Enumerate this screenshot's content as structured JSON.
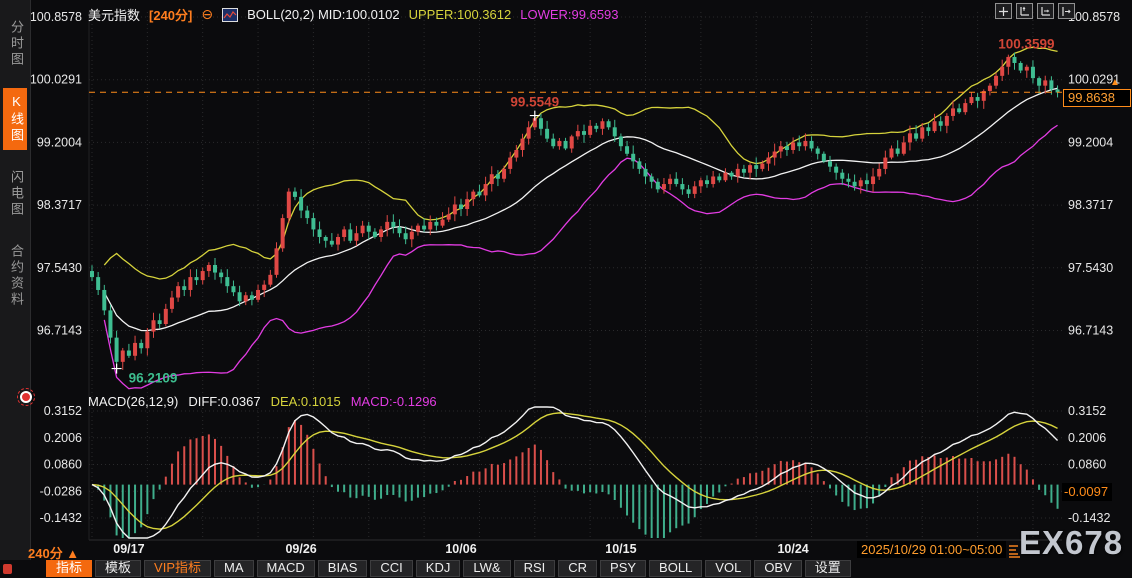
{
  "header": {
    "symbol": "美元指数",
    "period": "[240分]",
    "collapse_icon": "⊖",
    "boll_label": "BOLL(20,2)",
    "mid": "MID:100.0102",
    "upper": "UPPER:100.3612",
    "lower": "LOWER:99.6593"
  },
  "sidebar": {
    "tabs": [
      {
        "label": "分时图",
        "active": false
      },
      {
        "label": "K线图",
        "active": true
      },
      {
        "label": "闪电图",
        "active": false
      },
      {
        "label": "合约资料",
        "active": false
      }
    ]
  },
  "topright_buttons": [
    "crosshair",
    "scale-vertical-axis",
    "scale-horizontal-axis",
    "shift-right"
  ],
  "price_axis": {
    "current": "99.8638",
    "current_arrow": "▲"
  },
  "macd_header": {
    "name": "MACD(26,12,9)",
    "diff": "DIFF:0.0367",
    "dea": "DEA:0.1015",
    "macd": "MACD:-0.1296"
  },
  "macd_axis": {
    "current": "-0.0097"
  },
  "xaxis": {
    "period_label": "240分 ▲",
    "current_range": "2025/10/29 01:00~05:00"
  },
  "toolbar": {
    "items": [
      {
        "label": "指标",
        "variant": "active"
      },
      {
        "label": "模板",
        "variant": "plain"
      },
      {
        "label": "VIP指标",
        "variant": "vip"
      },
      {
        "label": "MA",
        "variant": "plain"
      },
      {
        "label": "MACD",
        "variant": "plain"
      },
      {
        "label": "BIAS",
        "variant": "plain"
      },
      {
        "label": "CCI",
        "variant": "plain"
      },
      {
        "label": "KDJ",
        "variant": "plain"
      },
      {
        "label": "LW&",
        "variant": "plain"
      },
      {
        "label": "RSI",
        "variant": "plain"
      },
      {
        "label": "CR",
        "variant": "plain"
      },
      {
        "label": "PSY",
        "variant": "plain"
      },
      {
        "label": "BOLL",
        "variant": "plain"
      },
      {
        "label": "VOL",
        "variant": "plain"
      },
      {
        "label": "OBV",
        "variant": "plain"
      },
      {
        "label": "设置",
        "variant": "plain"
      }
    ]
  },
  "watermark": "EX678",
  "colors": {
    "up": "#e04845",
    "down": "#3fbe92",
    "boll_upper": "#d6d33c",
    "boll_mid": "#f2f2f2",
    "boll_lower": "#e23ce2",
    "macd_bar_pos": "#da4f4b",
    "macd_bar_neg": "#3fae8c",
    "diff_line": "#f2f2f2",
    "dea_line": "#d6d33c",
    "grid": "#2a2a2c",
    "axis_text": "#e8e8e8",
    "orange": "#ff8c1a",
    "annot_red": "#d04536",
    "annot_green": "#3dbd8e"
  },
  "chart_data": {
    "type": "candlestick+macd",
    "title": "美元指数 240分 K线 + BOLL(20,2) + MACD(26,12,9)",
    "price_axis_ticks": [
      "100.8578",
      "100.0291",
      "99.2004",
      "98.3717",
      "97.5430",
      "96.7143"
    ],
    "macd_axis_ticks": [
      "0.3152",
      "0.2006",
      "0.0860",
      "-0.0286",
      "-0.1432"
    ],
    "last_price": 99.8638,
    "annotations": {
      "high": "100.3599",
      "mid_peak": "99.5549",
      "low": "96.2109"
    },
    "high_value": 100.3599,
    "mid_peak_value": 99.5549,
    "low_value": 96.2109,
    "boll": {
      "period": 20,
      "mult": 2,
      "mid": 100.0102,
      "upper": 100.3612,
      "lower": 99.6593
    },
    "macd": {
      "fast": 12,
      "slow": 26,
      "signal": 9,
      "diff": 0.0367,
      "dea": 0.1015,
      "hist": -0.1296
    },
    "date_ticks": [
      {
        "label": "09/17",
        "i": 6
      },
      {
        "label": "09/26",
        "i": 34
      },
      {
        "label": "10/06",
        "i": 60
      },
      {
        "label": "10/15",
        "i": 86
      },
      {
        "label": "10/24",
        "i": 114
      }
    ],
    "wick_overrides": {
      "4": {
        "low": 96.2109
      },
      "72": {
        "high": 99.5549
      },
      "149": {
        "high": 100.3599
      }
    },
    "annot_indices": {
      "low": 4,
      "mid_peak": 72,
      "high": 149
    },
    "closes": [
      97.42,
      97.25,
      96.98,
      96.62,
      96.3,
      96.45,
      96.38,
      96.55,
      96.48,
      96.7,
      96.85,
      96.8,
      97.0,
      97.15,
      97.3,
      97.25,
      97.42,
      97.38,
      97.5,
      97.58,
      97.48,
      97.42,
      97.3,
      97.22,
      97.1,
      97.18,
      97.12,
      97.25,
      97.32,
      97.45,
      97.8,
      98.2,
      98.55,
      98.48,
      98.3,
      98.2,
      98.05,
      97.95,
      97.9,
      97.85,
      97.95,
      98.05,
      97.9,
      98.0,
      98.1,
      98.02,
      97.95,
      98.05,
      98.15,
      98.08,
      98.0,
      97.92,
      98.02,
      98.1,
      98.05,
      98.15,
      98.1,
      98.18,
      98.25,
      98.38,
      98.32,
      98.45,
      98.55,
      98.5,
      98.65,
      98.78,
      98.72,
      98.85,
      99.0,
      99.1,
      99.25,
      99.4,
      99.52,
      99.38,
      99.25,
      99.15,
      99.22,
      99.12,
      99.28,
      99.35,
      99.3,
      99.42,
      99.38,
      99.48,
      99.4,
      99.28,
      99.15,
      99.05,
      98.95,
      98.85,
      98.75,
      98.68,
      98.58,
      98.65,
      98.72,
      98.65,
      98.58,
      98.52,
      98.62,
      98.7,
      98.65,
      98.75,
      98.7,
      98.8,
      98.75,
      98.85,
      98.8,
      98.9,
      98.85,
      98.92,
      99.0,
      99.08,
      99.15,
      99.1,
      99.2,
      99.15,
      99.22,
      99.12,
      99.05,
      98.95,
      98.88,
      98.8,
      98.72,
      98.68,
      98.62,
      98.7,
      98.65,
      98.75,
      98.85,
      99.0,
      99.12,
      99.05,
      99.2,
      99.32,
      99.25,
      99.4,
      99.35,
      99.48,
      99.42,
      99.55,
      99.65,
      99.6,
      99.72,
      99.8,
      99.75,
      99.88,
      99.95,
      100.08,
      100.2,
      100.33,
      100.25,
      100.15,
      100.2,
      100.05,
      99.95,
      100.02,
      99.9,
      99.86
    ]
  }
}
